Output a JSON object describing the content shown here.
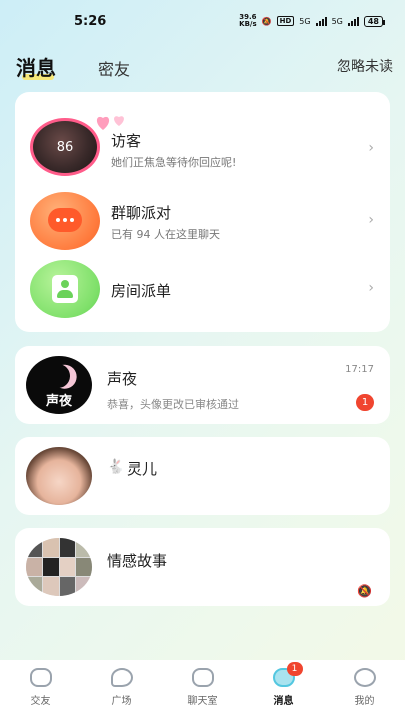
{
  "status_bar": {
    "time": "5:26",
    "net_speed_value": "39.6",
    "net_speed_unit": "KB/s",
    "hd": "HD",
    "sim1": "5G",
    "sim2": "5G",
    "battery": "48"
  },
  "header": {
    "tab_messages": "消息",
    "tab_friends": "密友",
    "ignore_unread": "忽略未读"
  },
  "system_card": {
    "items": [
      {
        "title": "访客",
        "subtitle": "她们正焦急等待你回应呢!",
        "avatar_count": "86"
      },
      {
        "title": "群聊派对",
        "subtitle": "已有 94 人在这里聊天"
      },
      {
        "title": "房间派单",
        "subtitle": ""
      }
    ]
  },
  "conversations": [
    {
      "name": "声夜",
      "avatar_text": "声夜",
      "preview": "恭喜，头像更改已审核通过",
      "time": "17:17",
      "unread": "1"
    },
    {
      "name": "灵儿",
      "prefix_icon": "bunny-icon",
      "preview": "",
      "time": ""
    },
    {
      "name": "情感故事",
      "preview": "",
      "time": "",
      "muted": true
    }
  ],
  "bottom_nav": {
    "items": [
      {
        "label": "交友",
        "icon": "heart-chat-icon",
        "active": false
      },
      {
        "label": "广场",
        "icon": "leaf-icon",
        "active": false
      },
      {
        "label": "聊天室",
        "icon": "heart-house-icon",
        "active": false
      },
      {
        "label": "消息",
        "icon": "message-icon",
        "active": true,
        "badge": "1"
      },
      {
        "label": "我的",
        "icon": "face-icon",
        "active": false
      }
    ]
  },
  "colors": {
    "accent": "#53c7e0",
    "badge": "#f0452f",
    "visitor_ring": "#ff5c8a",
    "group_orange": "#ff7a3c",
    "room_green": "#7fe06a"
  }
}
